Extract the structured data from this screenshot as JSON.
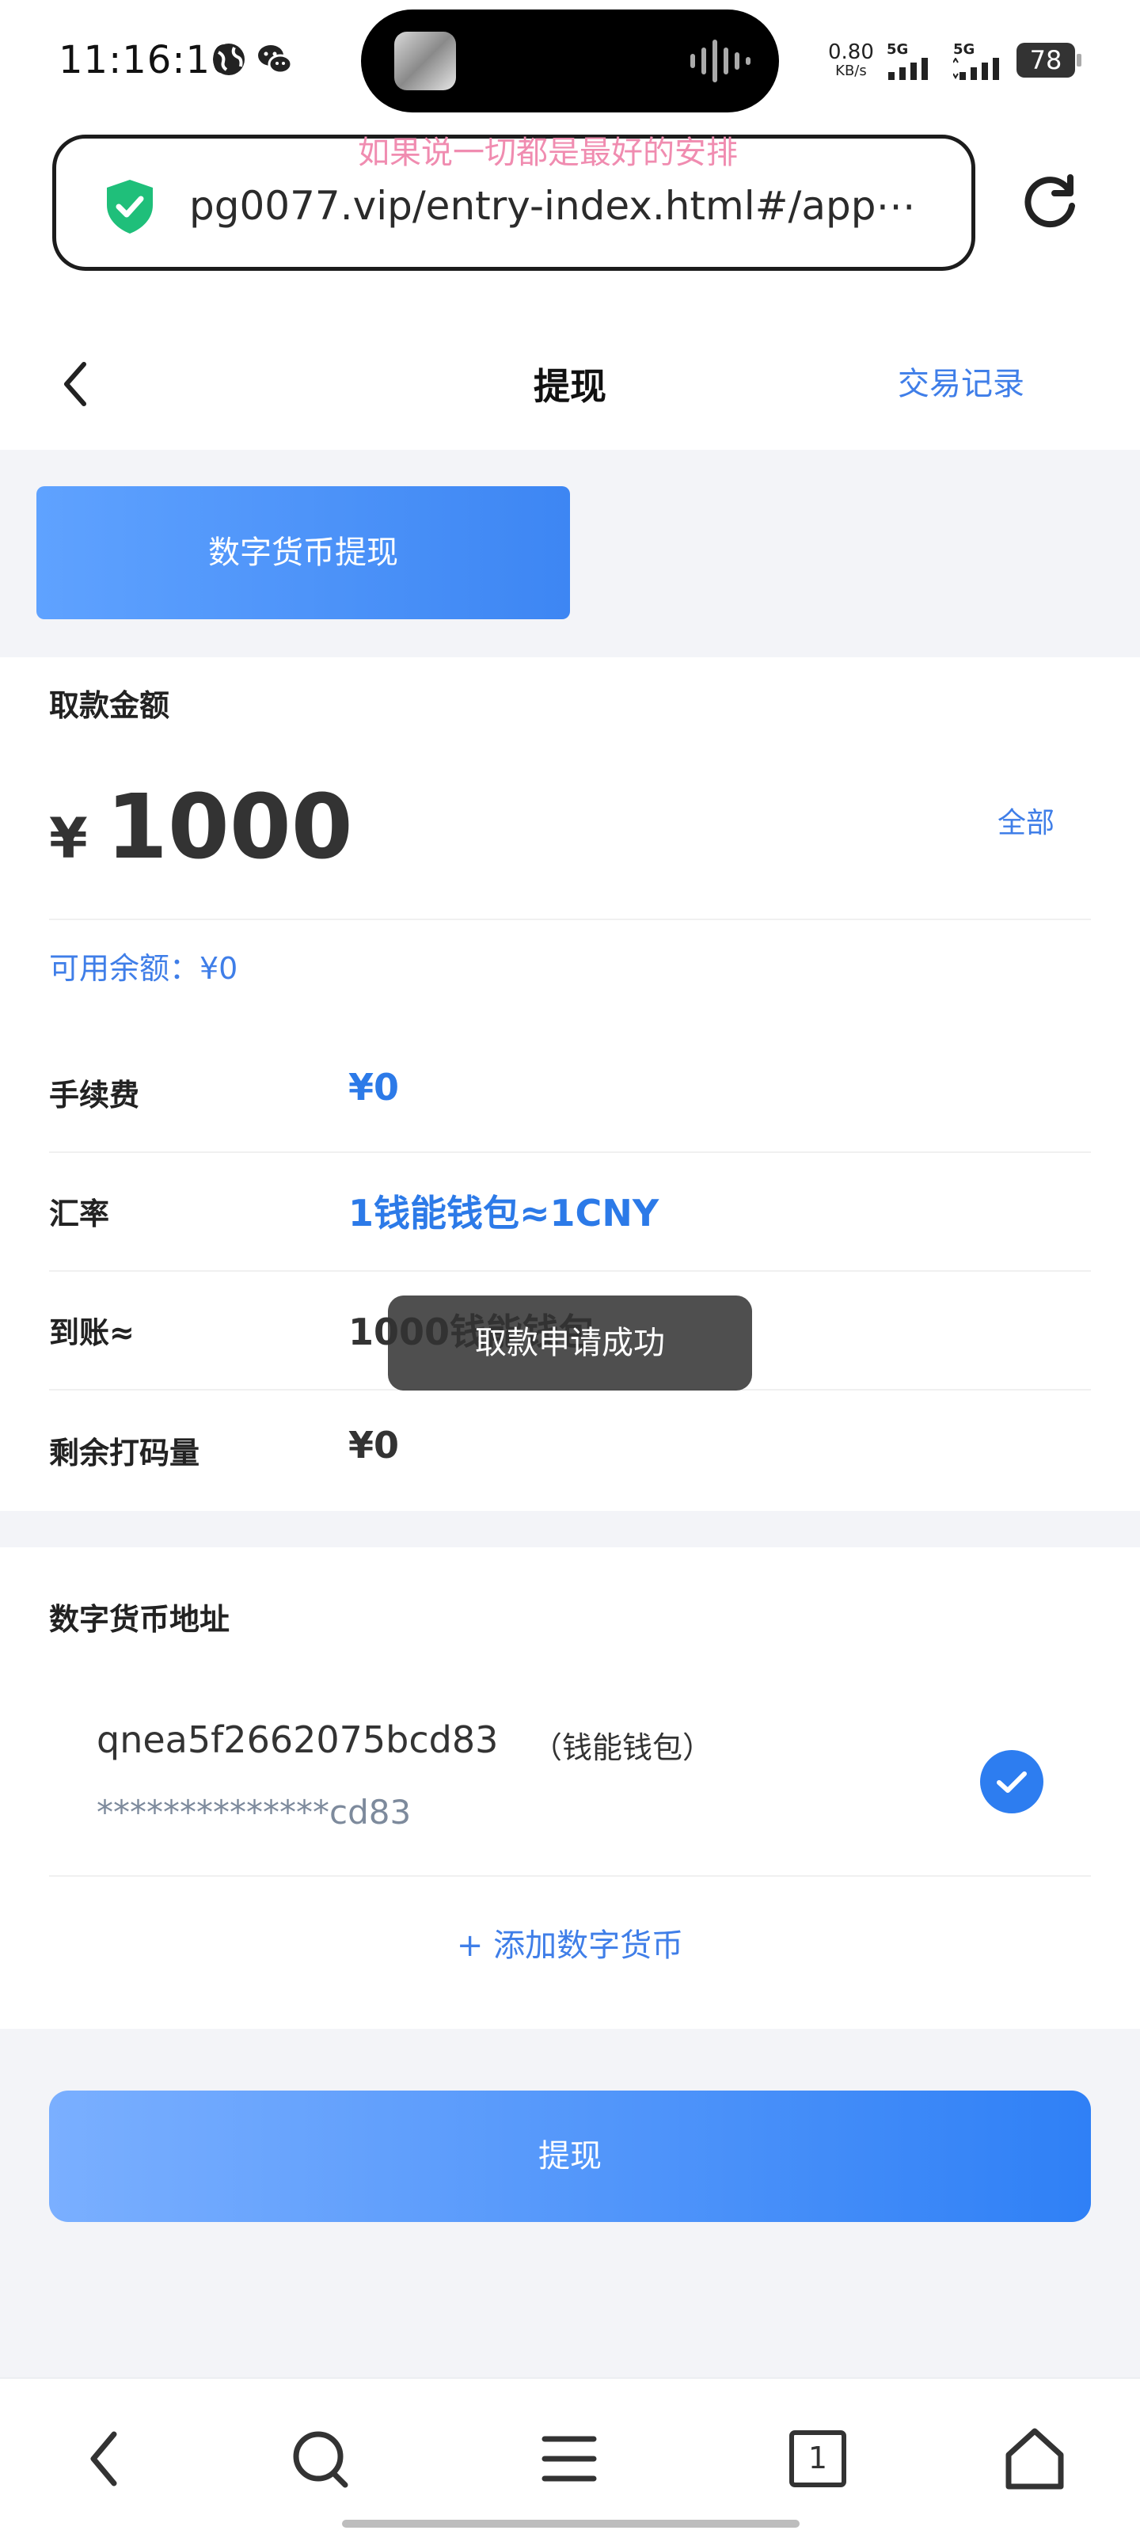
{
  "status_bar": {
    "time": "11:16:16",
    "net_speed_value": "0.80",
    "net_speed_unit": "KB/s",
    "signal1_label": "5G",
    "signal2_label": "5G",
    "battery": "78"
  },
  "browser": {
    "marquee_text": "如果说一切都是最好的安排",
    "url": "pg0077.vip/entry-index.html#/app⋯"
  },
  "header": {
    "title": "提现",
    "transactions_link": "交易记录"
  },
  "tabs": [
    {
      "label": "数字货币提现"
    }
  ],
  "amount_section": {
    "label": "取款金额",
    "currency_symbol": "¥",
    "amount": "1000",
    "all_link": "全部",
    "available": "可用余额：¥0"
  },
  "details": [
    {
      "label": "手续费",
      "value": "¥0",
      "color": "#2c7ae8"
    },
    {
      "label": "汇率",
      "value": "1钱能钱包≈1CNY",
      "color": "#2c7ae8"
    },
    {
      "label": "到账≈",
      "value": "1000钱能钱包",
      "color": "#333333"
    },
    {
      "label": "剩余打码量",
      "value": "¥0",
      "color": "#333333"
    }
  ],
  "address_section": {
    "label": "数字货币地址",
    "address_name": "qnea5f2662075bcd83",
    "address_tag": "（钱能钱包）",
    "address_masked": "**************cd83",
    "selected": true,
    "add_link": "+ 添加数字货币"
  },
  "submit_label": "提现",
  "toast": "取款申请成功",
  "colors": {
    "accent": "#3f7ee8",
    "button_gradient_start": "#7aafff",
    "button_gradient_end": "#2f80f6",
    "page_gray": "#f3f4f8"
  },
  "icons": {
    "status": [
      "globe-icon",
      "wechat-icon"
    ],
    "url_bar": [
      "shield-check-icon",
      "reload-icon"
    ],
    "nav": [
      "back-icon",
      "search-icon",
      "menu-icon",
      "tabs-icon",
      "home-icon"
    ]
  },
  "browser_nav": {
    "tab_count": "1"
  }
}
